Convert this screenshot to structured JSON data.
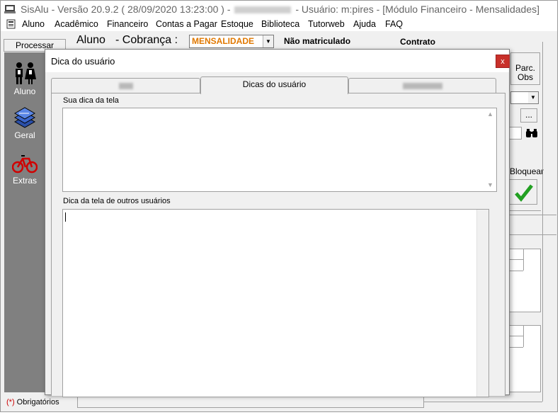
{
  "window": {
    "title_prefix": "SisAlu - Versão 20.9.2 ( 28/09/2020 13:23:00 ) -",
    "title_suffix": "- Usuário: m:pires - [Módulo Financeiro - Mensalidades]"
  },
  "menu": {
    "items": [
      "Aluno",
      "Acadêmico",
      "Financeiro",
      "Contas a Pagar",
      "Estoque",
      "Biblioteca",
      "Tutorweb",
      "Ajuda",
      "FAQ"
    ]
  },
  "sidebar": {
    "processar_label": "Processar",
    "items": [
      {
        "label": "Aluno",
        "icon": "people-icon"
      },
      {
        "label": "Geral",
        "icon": "stack-icon"
      },
      {
        "label": "Extras",
        "icon": "bicycle-icon"
      }
    ],
    "required_marker": "(*)",
    "required_label": "Obrigatórios"
  },
  "form": {
    "aluno_label": "Aluno",
    "cobranca_label": "- Cobrança :",
    "cobranca_value": "MENSALIDADE",
    "status_label": "Não matriculado",
    "contrato_label": "Contrato"
  },
  "right_controls": {
    "parc_obs_line1": "Parc.",
    "parc_obs_line2": "Obs",
    "ellipsis_label": "...",
    "bloquear_label": "Bloquear"
  },
  "dialog": {
    "title": "Dica do usuário",
    "close_label": "x",
    "tabs": [
      {
        "label": "",
        "active": false
      },
      {
        "label": "Dicas do usuário",
        "active": true
      },
      {
        "label": "",
        "active": false
      }
    ],
    "own_tip_label": "Sua dica da tela",
    "own_tip_value": "",
    "others_tip_label": "Dica da tela de outros usuários",
    "others_tip_value": ""
  },
  "colors": {
    "cobranca_value": "#e07800",
    "close_button": "#c8302a",
    "sidebar_bg": "#808080",
    "check": "#22a022"
  }
}
